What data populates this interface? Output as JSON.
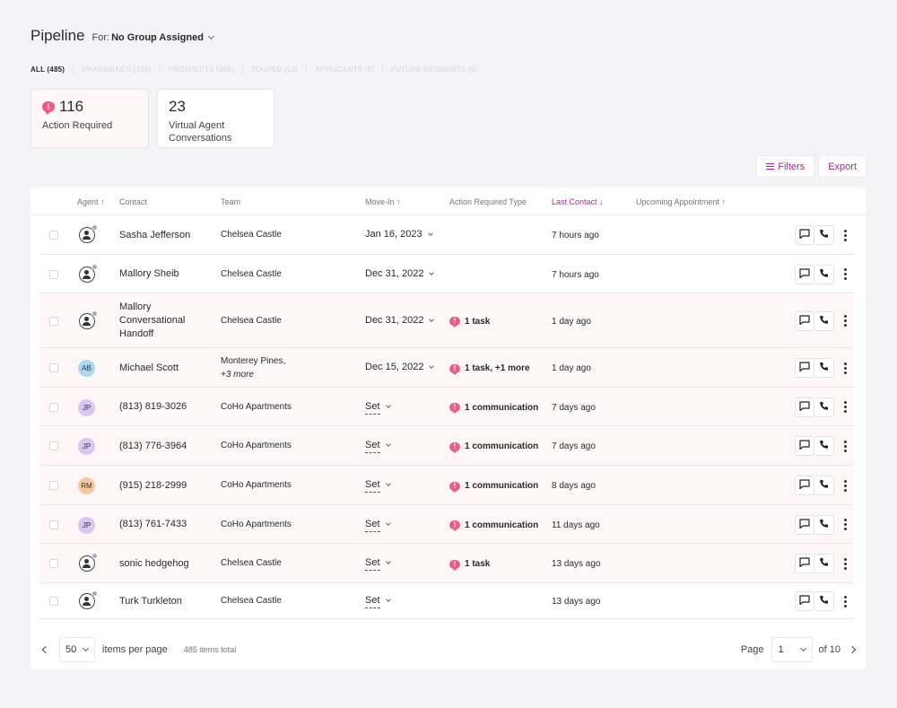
{
  "header": {
    "title": "Pipeline",
    "for_label": "For:",
    "group": "No Group Assigned"
  },
  "tabs": [
    {
      "label": "ALL (485)",
      "active": true
    },
    {
      "label": "UNASSIGNED (109)",
      "active": false
    },
    {
      "label": "PROSPECTS (368)",
      "active": false
    },
    {
      "label": "TOURED (13)",
      "active": false
    },
    {
      "label": "APPLICANTS (5)",
      "active": false
    },
    {
      "label": "FUTURE RESIDENTS (0)",
      "active": false
    }
  ],
  "cards": {
    "action_required": {
      "count": "116",
      "label": "Action Required",
      "icon": "alert-chat-icon"
    },
    "virtual_agent": {
      "count": "23",
      "label": "Virtual Agent Conversations"
    }
  },
  "toolbar": {
    "filters_label": "Filters",
    "export_label": "Export"
  },
  "table": {
    "columns": {
      "agent": "Agent",
      "contact": "Contact",
      "team": "Team",
      "move_in": "Move-In",
      "action_type": "Action Required Type",
      "last_contact": "Last Contact",
      "upcoming": "Upcoming Appointment"
    },
    "rows": [
      {
        "avatar": "person",
        "contact": "Sasha Jefferson",
        "team": "Chelsea Castle",
        "team_more": "",
        "move_in": "Jan 16, 2023",
        "action": "",
        "last_contact": "7 hours ago",
        "alert": false
      },
      {
        "avatar": "person",
        "contact": "Mallory Sheib",
        "team": "Chelsea Castle",
        "team_more": "",
        "move_in": "Dec 31, 2022",
        "action": "",
        "last_contact": "7 hours ago",
        "alert": false
      },
      {
        "avatar": "person",
        "contact": "Mallory Conversational Handoff",
        "team": "Chelsea Castle",
        "team_more": "",
        "move_in": "Dec 31, 2022",
        "action": "1 task",
        "last_contact": "1 day ago",
        "alert": true
      },
      {
        "avatar": "AB",
        "avatar_color": "#a9d8f0",
        "contact": "Michael Scott",
        "team": "Monterey Pines,",
        "team_more": "+3 more",
        "move_in": "Dec 15, 2022",
        "action": "1 task, +1 more",
        "last_contact": "1 day ago",
        "alert": true
      },
      {
        "avatar": "JP",
        "avatar_color": "#d9c6f2",
        "contact": "(813) 819-3026",
        "team": "CoHo Apartments",
        "team_more": "",
        "move_in": "Set",
        "action": "1 communication",
        "last_contact": "7 days ago",
        "alert": true
      },
      {
        "avatar": "JP",
        "avatar_color": "#d9c6f2",
        "contact": "(813) 776-3964",
        "team": "CoHo Apartments",
        "team_more": "",
        "move_in": "Set",
        "action": "1 communication",
        "last_contact": "7 days ago",
        "alert": true
      },
      {
        "avatar": "RM",
        "avatar_color": "#f6c8a0",
        "contact": "(915) 218-2999",
        "team": "CoHo Apartments",
        "team_more": "",
        "move_in": "Set",
        "action": "1 communication",
        "last_contact": "8 days ago",
        "alert": true
      },
      {
        "avatar": "JP",
        "avatar_color": "#d9c6f2",
        "contact": "(813) 761-7433",
        "team": "CoHo Apartments",
        "team_more": "",
        "move_in": "Set",
        "action": "1 communication",
        "last_contact": "11 days ago",
        "alert": true
      },
      {
        "avatar": "person",
        "contact": "sonic hedgehog",
        "team": "Chelsea Castle",
        "team_more": "",
        "move_in": "Set",
        "action": "1 task",
        "last_contact": "13 days ago",
        "alert": true
      },
      {
        "avatar": "person",
        "contact": "Turk Turkleton",
        "team": "Chelsea Castle",
        "team_more": "",
        "move_in": "Set",
        "action": "",
        "last_contact": "13 days ago",
        "alert": false
      }
    ]
  },
  "footer": {
    "per_page_value": "50",
    "per_page_label": "items per page",
    "total": "485 items total",
    "page_label": "Page",
    "page_value": "1",
    "of_label": "of 10"
  },
  "colors": {
    "accent": "#c0209a",
    "alert": "#ee5b8a",
    "alert_row_bg": "#fff6f8"
  }
}
